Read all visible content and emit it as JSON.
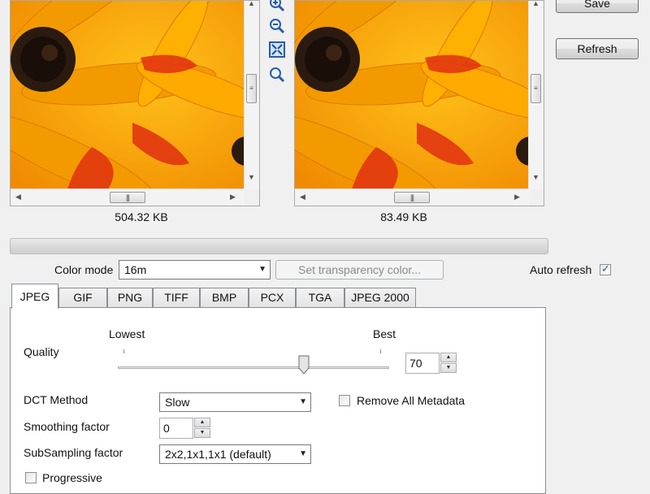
{
  "toolbar": {
    "save_label": "Save",
    "refresh_label": "Refresh",
    "icons": [
      "zoom-in-icon",
      "zoom-out-icon",
      "fit-to-window-icon",
      "actual-size-icon"
    ]
  },
  "previews": {
    "original_size": "504.32 KB",
    "compressed_size": "83.49 KB"
  },
  "options": {
    "color_mode_label": "Color mode",
    "color_mode_value": "16m",
    "transparency_button": "Set transparency color...",
    "auto_refresh_label": "Auto refresh",
    "auto_refresh_checked": true
  },
  "tabs": [
    "JPEG",
    "GIF",
    "PNG",
    "TIFF",
    "BMP",
    "PCX",
    "TGA",
    "JPEG 2000"
  ],
  "jpeg": {
    "quality_label": "Quality",
    "lowest_label": "Lowest",
    "best_label": "Best",
    "quality_value": "70",
    "dct_label": "DCT Method",
    "dct_value": "Slow",
    "remove_metadata_label": "Remove All Metadata",
    "smoothing_label": "Smoothing factor",
    "smoothing_value": "0",
    "subsampling_label": "SubSampling factor",
    "subsampling_value": "2x2,1x1,1x1 (default)",
    "progressive_label": "Progressive"
  },
  "colors": {
    "flower_orange": "#f7a400",
    "flower_center": "#2a1a10",
    "check_blue": "#2a5ba8"
  }
}
